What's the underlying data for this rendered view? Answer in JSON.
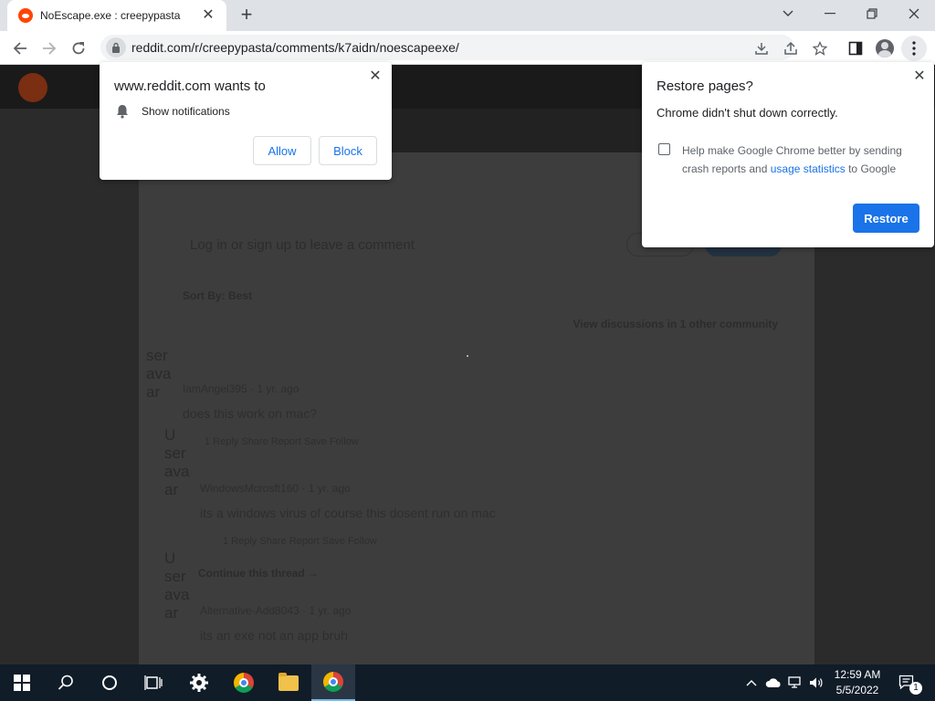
{
  "browser": {
    "tab": {
      "title": "NoEscape.exe : creepypasta",
      "close": "✕"
    },
    "new_tab": "+",
    "window_controls": {
      "minimize": "—",
      "restore": "❐",
      "close": "✕",
      "tab_search": "⌄"
    },
    "url": "reddit.com/r/creepypasta/comments/k7aidn/noescapeexe/"
  },
  "notification_prompt": {
    "title": "www.reddit.com wants to",
    "permission": "Show notifications",
    "allow": "Allow",
    "block": "Block",
    "close": "✕"
  },
  "restore_prompt": {
    "title": "Restore pages?",
    "message": "Chrome didn't shut down correctly.",
    "checkbox_text_before": "Help make Google Chrome better by sending crash reports and ",
    "checkbox_link": "usage statistics",
    "checkbox_text_after": " to Google",
    "checkbox_checked": false,
    "button": "Restore",
    "close": "✕"
  },
  "page": {
    "comment_prompt": "Log in or sign up to leave a comment",
    "sort_label": "Sort By: Best",
    "other_discussions": "View discussions in 1 other community",
    "avatar_alt_1": "ser ava ar",
    "avatar_alt_2": "U ser ava ar",
    "avatar_alt_3": "U ser ava ar",
    "comments": [
      {
        "author": "IamAngel395 · 1 yr. ago",
        "text": "does this work on mac?",
        "actions": "1     Reply   Share   Report   Save   Follow"
      },
      {
        "author": "WindowsMcrosft160 · 1 yr. ago",
        "text": "its a windows virus of course this dosent run on mac",
        "actions": "1     Reply   Share   Report   Save   Follow"
      },
      {
        "author": "Alternative-Add8043 · 1 yr. ago",
        "text": "its an exe not an app bruh",
        "actions": ""
      }
    ],
    "continue_thread": "Continue this thread →"
  },
  "taskbar": {
    "clock_time": "12:59 AM",
    "clock_date": "5/5/2022",
    "notification_count": "1"
  }
}
